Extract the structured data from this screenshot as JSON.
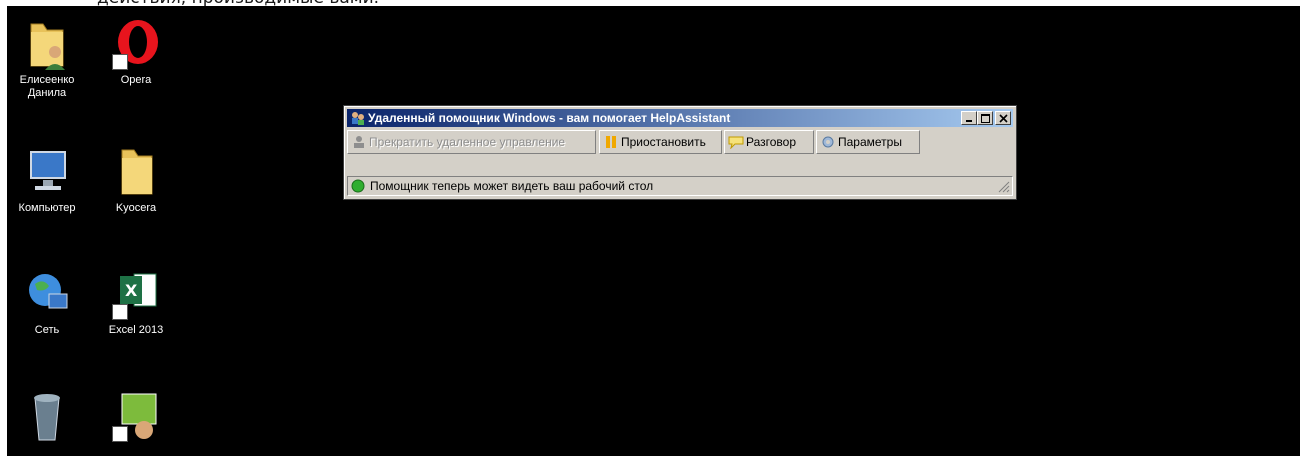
{
  "caption": "действия, производимые вами.",
  "desktop_icons": [
    {
      "label": "Елисеенко\nДанила"
    },
    {
      "label": "Opera"
    },
    {
      "label": "Компьютер"
    },
    {
      "label": "Kyocera"
    },
    {
      "label": "Сеть"
    },
    {
      "label": "Excel 2013"
    },
    {
      "label": ""
    },
    {
      "label": ""
    }
  ],
  "window": {
    "title": "Удаленный помощник Windows - вам помогает HelpAssistant",
    "toolbar": {
      "stop_control": "Прекратить удаленное управление",
      "pause": "Приостановить",
      "chat": "Разговор",
      "settings": "Параметры"
    },
    "status": "Помощник теперь может видеть ваш рабочий стол"
  }
}
